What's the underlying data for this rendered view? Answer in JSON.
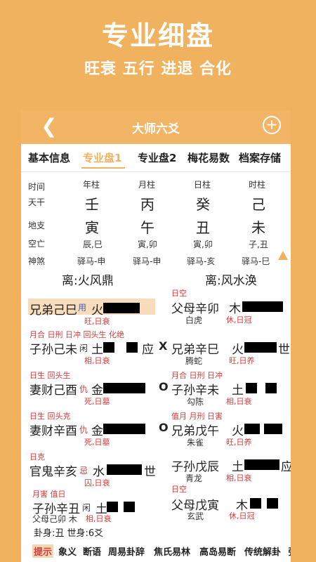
{
  "promo": {
    "title": "专业细盘",
    "subtitle": "旺衰 五行 进退 合化"
  },
  "nav": {
    "title": "大师六爻",
    "back_icon": "chevron-left-icon",
    "add_icon": "plus-circle-icon"
  },
  "tabs": [
    "基本信息",
    "专业盘1",
    "专业盘2",
    "梅花易数",
    "档案存储"
  ],
  "active_tab": "专业盘1",
  "pillars": {
    "labels": {
      "time": "时间",
      "tiangan": "天干",
      "dizhi": "地支",
      "kongwang": "空亡",
      "shensha": "神煞"
    },
    "columns": [
      {
        "header": "年柱",
        "tiangan": "壬",
        "dizhi": "寅",
        "kongwang": "辰,巳",
        "shensha": "驿马-申"
      },
      {
        "header": "月柱",
        "tiangan": "丙",
        "dizhi": "午",
        "kongwang": "寅,卯",
        "shensha": "驿马-申"
      },
      {
        "header": "日柱",
        "tiangan": "癸",
        "dizhi": "丑",
        "kongwang": "寅,卯",
        "shensha": "驿马-亥"
      },
      {
        "header": "时柱",
        "tiangan": "己",
        "dizhi": "未",
        "kongwang": "子,丑",
        "shensha": "驿马-巳"
      }
    ]
  },
  "gua": {
    "main": "离:火风鼎",
    "changed": "离:风水涣"
  },
  "left_lines": [
    {
      "tags": "",
      "main": "兄弟己巳",
      "mark": "用",
      "element": "火",
      "sub": "旺,日衰",
      "shi": "",
      "dong": ""
    },
    {
      "tags": "月合 日刑 日冲 回头生 化绝",
      "main": "子孙己未",
      "mark": "闲",
      "element": "土",
      "sub": "相,日衰",
      "shi": "应",
      "dong": "X"
    },
    {
      "tags": "日生 回头生",
      "main": "妻财己酉",
      "mark": "仇",
      "element": "金",
      "sub": "死,日墓",
      "shi": "",
      "dong": "O"
    },
    {
      "tags": "日生 回头克",
      "main": "妻财辛酉",
      "mark": "仇",
      "element": "金",
      "sub": "死,日墓",
      "shi": "",
      "dong": "O"
    },
    {
      "tags": "日克",
      "main": "官鬼辛亥",
      "mark": "忌",
      "element": "水",
      "sub": "囚,日衰",
      "shi": "世",
      "dong": ""
    },
    {
      "tags": "月害 值日",
      "main": "子孙辛丑",
      "mark": "闲",
      "element": "土",
      "sub": "相,日衰",
      "shi": "",
      "dong": ""
    }
  ],
  "left_extra": "父母己卯 木",
  "right_lines": [
    {
      "tags": "日空",
      "main": "父母辛卯",
      "element": "木",
      "god": "白虎",
      "sub": "休,日冠",
      "shi": ""
    },
    {
      "tags": "",
      "main": "兄弟辛巳",
      "element": "火",
      "god": "腾蛇",
      "sub": "旺,日养",
      "shi": "世"
    },
    {
      "tags": "月合 日刑 日冲",
      "main": "子孙辛未",
      "element": "土",
      "god": "勾陈",
      "sub": "相,日衰",
      "shi": ""
    },
    {
      "tags": "值月 月刑 日害",
      "main": "兄弟戊午",
      "element": "火",
      "god": "朱雀",
      "sub": "旺,日养",
      "shi": ""
    },
    {
      "tags": "",
      "main": "子孙戊辰",
      "element": "土",
      "god": "青龙",
      "sub": "相,日衰",
      "shi": "应"
    },
    {
      "tags": "日空",
      "main": "父母戊寅",
      "element": "木",
      "god": "玄武",
      "sub": "休,日冠",
      "shi": ""
    }
  ],
  "gua_body": "卦身:丑 世身:6爻",
  "bottom_tabs": [
    "提示",
    "象义",
    "断语",
    "周易卦辞",
    "焦氏易林",
    "高岛易断",
    "传统解卦",
    "张"
  ],
  "colors": {
    "accent": "#f0b25e",
    "red": "#d23c3c",
    "blue": "#3a63c8"
  }
}
